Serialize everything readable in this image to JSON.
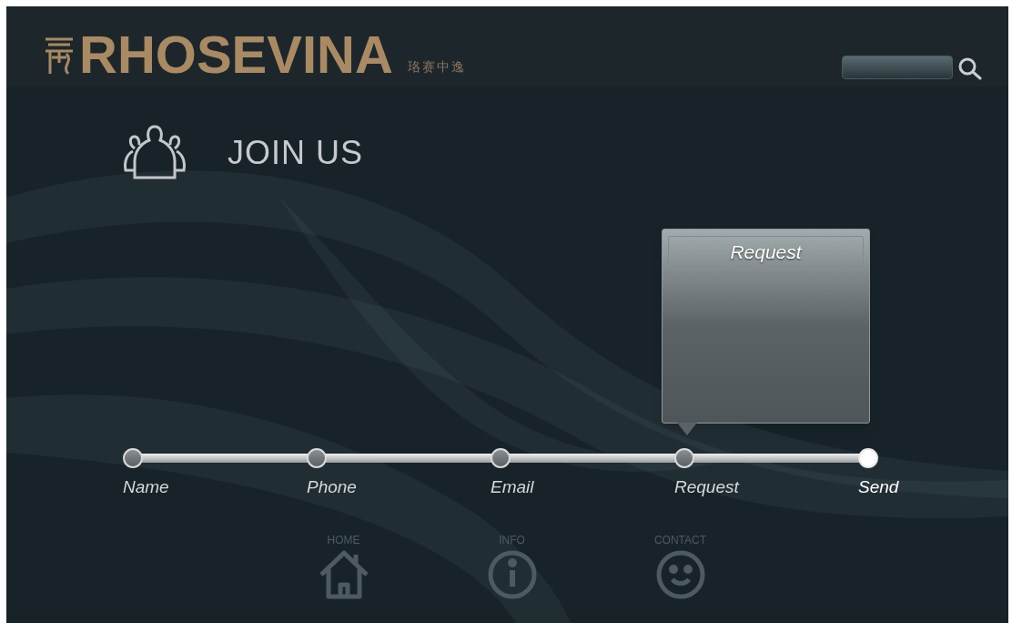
{
  "header": {
    "brand": "RHOSEVINA",
    "brand_chinese": "珞赛中逸"
  },
  "page_title": "JOIN US",
  "tooltip": {
    "title": "Request"
  },
  "steps": [
    {
      "label": "Name",
      "selected": false
    },
    {
      "label": "Phone",
      "selected": false
    },
    {
      "label": "Email",
      "selected": false
    },
    {
      "label": "Request",
      "selected": false
    },
    {
      "label": "Send",
      "selected": true
    }
  ],
  "nav": [
    {
      "kind": "home",
      "label": "HOME"
    },
    {
      "kind": "info",
      "label": "INFO"
    },
    {
      "kind": "contact",
      "label": "CONTACT"
    }
  ]
}
